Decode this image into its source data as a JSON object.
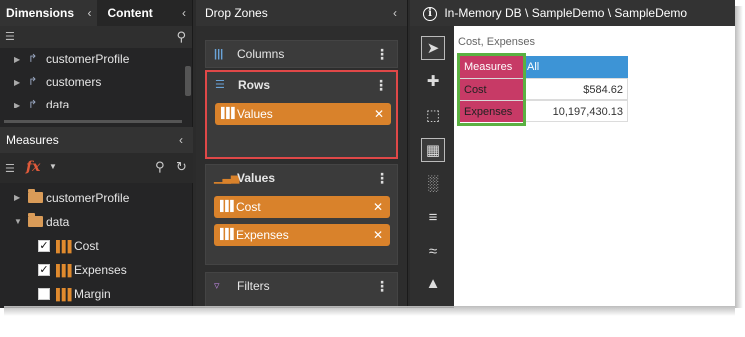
{
  "left_panel": {
    "tabs": [
      {
        "label": "Dimensions"
      },
      {
        "label": "Content"
      }
    ],
    "dimension_items": [
      {
        "label": "customerProfile"
      },
      {
        "label": "customers"
      },
      {
        "label": "data"
      }
    ],
    "measures_title": "Measures",
    "measure_tree": {
      "folders": [
        {
          "label": "customerProfile"
        },
        {
          "label": "data"
        }
      ],
      "items": [
        {
          "label": "Cost",
          "checked": true
        },
        {
          "label": "Expenses",
          "checked": true
        },
        {
          "label": "Margin",
          "checked": false
        }
      ]
    }
  },
  "drop_zones": {
    "title": "Drop Zones",
    "columns": {
      "label": "Columns"
    },
    "rows": {
      "label": "Rows",
      "chips": [
        {
          "label": "Values"
        }
      ]
    },
    "values": {
      "label": "Values",
      "chips": [
        {
          "label": "Cost"
        },
        {
          "label": "Expenses"
        }
      ]
    },
    "filters": {
      "label": "Filters"
    }
  },
  "report": {
    "path": "In-Memory DB \\ SampleDemo \\ SampleDemo",
    "subtitle": "Cost, Expenses",
    "table": {
      "header": {
        "measures": "Measures",
        "all": "All"
      },
      "rows": [
        {
          "measure": "Cost",
          "value": "$584.62"
        },
        {
          "measure": "Expenses",
          "value": "10,197,430.13"
        }
      ]
    }
  },
  "colors": {
    "accent_orange": "#d9822b",
    "measures_pink": "#c73a66",
    "header_blue": "#3d94d6",
    "highlight_red": "#e04848",
    "highlight_green": "#5bb142"
  }
}
